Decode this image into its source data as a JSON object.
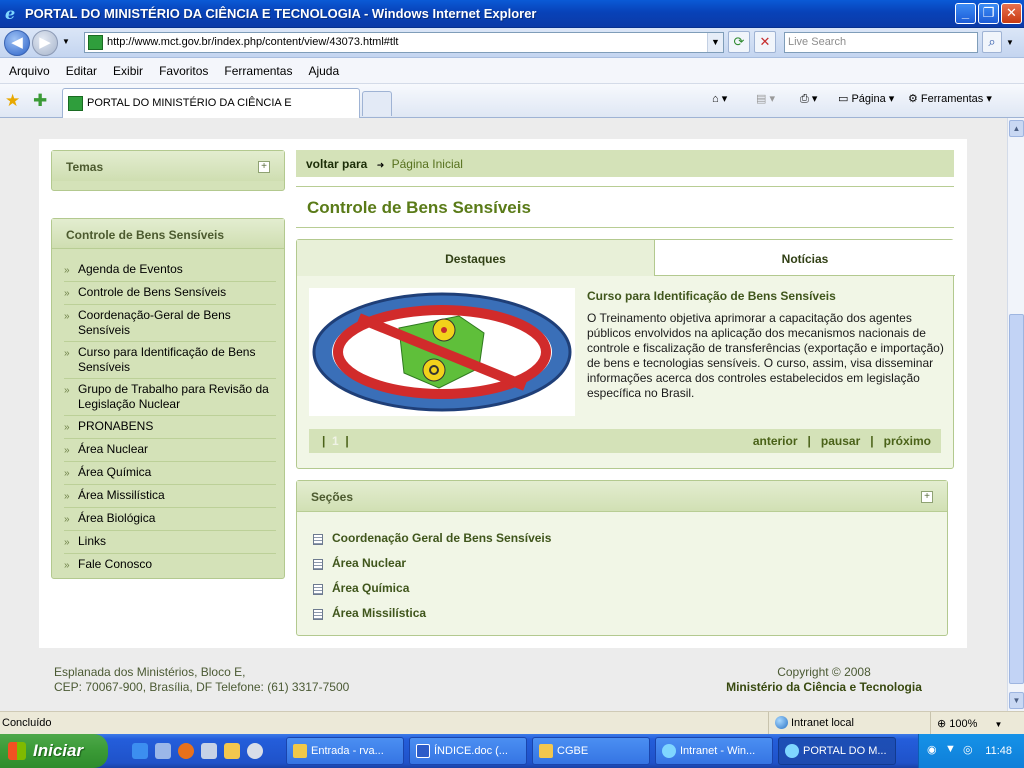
{
  "window": {
    "title": "PORTAL DO MINISTÉRIO DA CIÊNCIA E TECNOLOGIA - Windows Internet Explorer"
  },
  "address": {
    "url": "http://www.mct.gov.br/index.php/content/view/43073.html#tlt",
    "search_placeholder": "Live Search"
  },
  "menu": [
    "Arquivo",
    "Editar",
    "Exibir",
    "Favoritos",
    "Ferramentas",
    "Ajuda"
  ],
  "tab": {
    "label": "PORTAL DO MINISTÉRIO DA CIÊNCIA E TECNOLOGIA"
  },
  "toolbar": {
    "page_label": "Página",
    "tools_label": "Ferramentas"
  },
  "sidebar": {
    "temas_title": "Temas",
    "section_title": "Controle de Bens Sensíveis",
    "items": [
      {
        "label": "Agenda de Eventos"
      },
      {
        "label": "Controle de Bens Sensíveis"
      },
      {
        "label": "Coordenação-Geral de Bens Sensíveis"
      },
      {
        "label": "Curso para Identificação de Bens Sensíveis"
      },
      {
        "label": "Grupo de Trabalho para Revisão da Legislação Nuclear"
      },
      {
        "label": "PRONABENS"
      },
      {
        "label": "Área Nuclear"
      },
      {
        "label": "Área Química"
      },
      {
        "label": "Área Missilística"
      },
      {
        "label": "Área Biológica"
      },
      {
        "label": "Links"
      },
      {
        "label": "Fale Conosco"
      }
    ]
  },
  "breadcrumb": {
    "prefix": "voltar para",
    "link": "Página Inicial"
  },
  "page_title": "Controle de Bens Sensíveis",
  "tabs": {
    "destaques": "Destaques",
    "noticias": "Notícias"
  },
  "article": {
    "title": "Curso para Identificação de Bens Sensíveis",
    "text": "O Treinamento objetiva aprimorar a capacitação dos agentes públicos envolvidos na aplicação dos mecanismos nacionais de controle e fiscalização de transferências (exportação e importação) de bens e tecnologias sensíveis. O curso, assim, visa disseminar informações acerca dos controles estabelecidos em legislação específica no Brasil."
  },
  "pager": {
    "prefix": "|",
    "current": "1",
    "suffix": "|",
    "prev": "anterior",
    "pause": "pausar",
    "next": "próximo",
    "sep": "|"
  },
  "secoes": {
    "title": "Seções",
    "items": [
      {
        "label": "Coordenação Geral de Bens Sensíveis"
      },
      {
        "label": "Área Nuclear"
      },
      {
        "label": "Área Química"
      },
      {
        "label": "Área Missilística"
      }
    ]
  },
  "footer": {
    "address_line1": "Esplanada dos Ministérios, Bloco E,",
    "address_line2": "CEP: 70067-900, Brasília, DF Telefone: (61) 3317-7500",
    "copyright": "Copyright © 2008",
    "ministry": "Ministério da Ciência e Tecnologia"
  },
  "status": {
    "text": "Concluído",
    "zone": "Intranet local",
    "zoom": "100%"
  },
  "taskbar": {
    "start": "Iniciar",
    "items": [
      {
        "label": "Entrada - rva..."
      },
      {
        "label": "ÍNDICE.doc (..."
      },
      {
        "label": "CGBE"
      },
      {
        "label": "Intranet - Win..."
      },
      {
        "label": "PORTAL DO M..."
      }
    ],
    "clock": "11:48"
  },
  "colors": {
    "accent_green": "#5a7b18",
    "panel_green": "#d4e2b8",
    "xp_blue": "#245edb"
  }
}
